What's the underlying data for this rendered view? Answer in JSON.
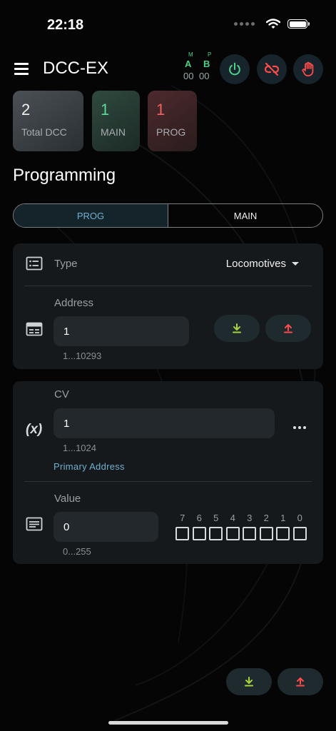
{
  "status_bar": {
    "time": "22:18"
  },
  "header": {
    "title": "DCC-EX",
    "tracks": [
      {
        "superscript": "M",
        "letter": "A",
        "count": "00"
      },
      {
        "superscript": "P",
        "letter": "B",
        "count": "00"
      }
    ]
  },
  "stats": [
    {
      "value": "2",
      "label": "Total DCC"
    },
    {
      "value": "1",
      "label": "MAIN"
    },
    {
      "value": "1",
      "label": "PROG"
    }
  ],
  "section_title": "Programming",
  "tabs": {
    "prog": "PROG",
    "main": "MAIN"
  },
  "loco": {
    "type_label": "Type",
    "type_value": "Locomotives",
    "address_label": "Address",
    "address_value": "1",
    "address_range": "1...10293"
  },
  "cv": {
    "symbol": "(x)",
    "cv_label": "CV",
    "cv_value": "1",
    "cv_range": "1...1024",
    "cv_name": "Primary Address",
    "value_label": "Value",
    "value_value": "0",
    "value_range": "0...255",
    "bits": [
      "7",
      "6",
      "5",
      "4",
      "3",
      "2",
      "1",
      "0"
    ]
  },
  "colors": {
    "accent_blue": "#6fb0cf",
    "green": "#4ecf88",
    "red": "#ff4a4a",
    "download_green": "#a6d33a"
  }
}
